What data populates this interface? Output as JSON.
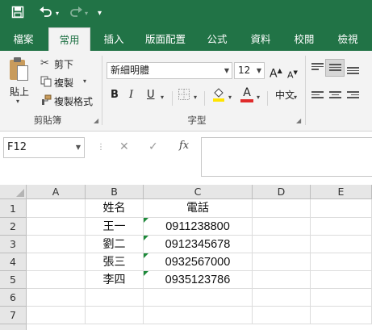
{
  "quick_access": {
    "save_icon": "save-icon",
    "undo_icon": "undo-icon",
    "redo_icon": "redo-icon",
    "customize_icon": "customize-qat-icon"
  },
  "tabs": [
    {
      "label": "檔案"
    },
    {
      "label": "常用",
      "active": true
    },
    {
      "label": "插入"
    },
    {
      "label": "版面配置"
    },
    {
      "label": "公式"
    },
    {
      "label": "資料"
    },
    {
      "label": "校閱"
    },
    {
      "label": "檢視"
    }
  ],
  "clipboard": {
    "group_label": "剪貼簿",
    "paste_label": "貼上",
    "cut_label": "剪下",
    "copy_label": "複製",
    "format_painter_label": "複製格式"
  },
  "font": {
    "group_label": "字型",
    "font_name": "新細明體",
    "font_size": "12",
    "bold": "B",
    "italic": "I",
    "underline": "U",
    "grow": "A",
    "shrink": "A",
    "font_color_letter": "A",
    "font_color": "#e02b2b",
    "fill_color": "#ffe400",
    "phonetic": "中文"
  },
  "formula_bar": {
    "name_box": "F12",
    "cancel": "✕",
    "enter": "✓",
    "fx": "fx",
    "formula": ""
  },
  "sheet": {
    "columns": [
      "A",
      "B",
      "C",
      "D",
      "E"
    ],
    "rows": [
      "1",
      "2",
      "3",
      "4",
      "5",
      "6",
      "7"
    ],
    "cells": {
      "B1": "姓名",
      "C1": "電話",
      "B2": "王一",
      "C2": "0911238800",
      "B3": "劉二",
      "C3": "0912345678",
      "B4": "張三",
      "C4": "0932567000",
      "B5": "李四",
      "C5": "0935123786"
    }
  },
  "colors": {
    "excel_green": "#217346",
    "header_gray": "#e6e6e6",
    "error_indicator": "#1d8a3a"
  }
}
